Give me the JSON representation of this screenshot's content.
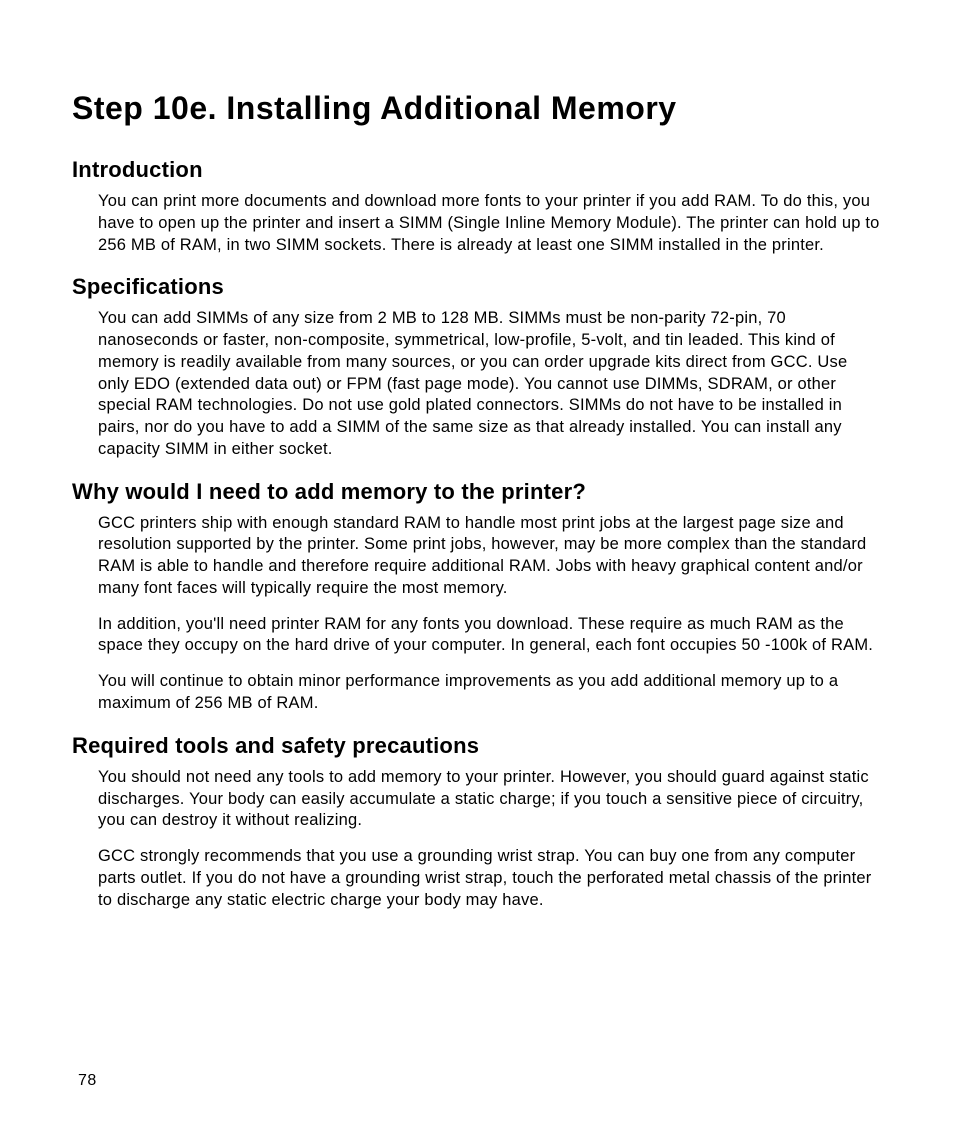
{
  "title": "Step 10e. Installing Additional Memory",
  "sections": {
    "intro": {
      "heading": "Introduction",
      "p1": "You can print more documents and download more fonts to your printer if you add RAM. To do this, you have to open up the printer and insert a SIMM (Single Inline Memory Module). The printer can hold up to 256 MB of RAM, in two SIMM sockets. There is already at least one SIMM installed in the printer."
    },
    "specs": {
      "heading": "Specifications",
      "p1": "You can add SIMMs of any size from 2 MB to 128 MB. SIMMs must be non-parity 72-pin, 70 nanoseconds or faster, non-composite, symmetrical, low-profile, 5-volt, and tin leaded. This kind of memory is readily available from many sources, or you can order upgrade kits direct from GCC. Use only EDO (extended data out) or FPM (fast page mode). You cannot use DIMMs, SDRAM, or other special RAM technologies. Do not use gold plated connectors. SIMMs do not have to be installed in pairs, nor do you have to add a SIMM of the same size as that already installed. You can install any capacity SIMM in either socket."
    },
    "why": {
      "heading": "Why would I need to add memory to the printer?",
      "p1": "GCC printers ship with enough standard RAM to handle most print jobs at the largest page size and resolution supported by the printer. Some print jobs, however, may be more complex than the standard RAM is able to handle and therefore require additional RAM. Jobs with heavy graphical content and/or many font faces will typically require the most memory.",
      "p2": "In addition, you'll need printer RAM for any fonts you download. These require as much RAM as the space they occupy on the hard drive of your computer. In general, each font occupies 50 -100k of RAM.",
      "p3": "You will continue to obtain minor performance improvements as you add additional memory up to a maximum of 256 MB of RAM."
    },
    "tools": {
      "heading": "Required tools and safety precautions",
      "p1": "You should not need any tools to add memory to your printer. However, you should guard against static discharges. Your body can easily accumulate a static charge; if you touch a sensitive piece of circuitry, you can destroy it without realizing.",
      "p2": "GCC strongly recommends that you use a grounding wrist strap. You can buy one from any computer parts outlet. If you do not have a grounding wrist strap, touch the perforated metal chassis of the printer to discharge any static electric charge your body may have."
    }
  },
  "page_number": "78"
}
